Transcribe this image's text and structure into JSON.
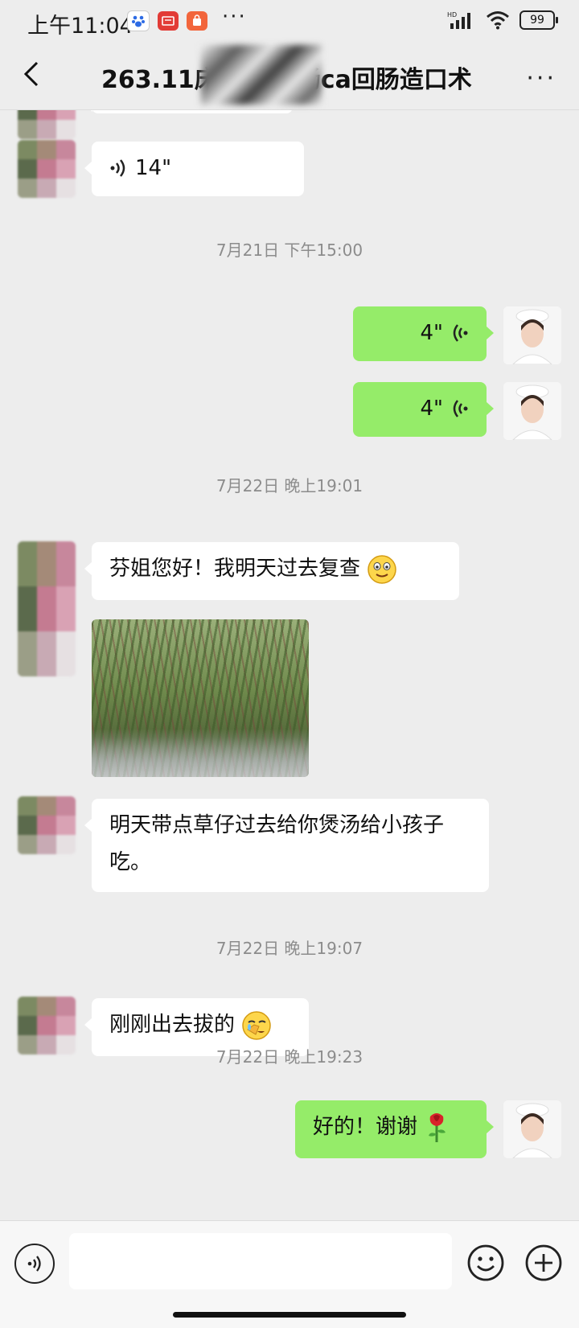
{
  "status_bar": {
    "time": "上午11:04",
    "network": "HD",
    "battery": "99",
    "more": "···"
  },
  "nav": {
    "title": "263.11床林 ██ 肠ca回肠造口术",
    "more": "···"
  },
  "messages": {
    "m1_voice": "14\"",
    "t1": "7月21日 下午15:00",
    "m2_voice": "4\"",
    "m3_voice": "4\"",
    "t2": "7月22日 晚上19:01",
    "m4_text": "芬姐您好！我明天过去复查",
    "m6_text": "明天带点草仔过去给你煲汤给小孩子吃。",
    "t3": "7月22日 晚上19:07",
    "m7_text": "刚刚出去拔的",
    "t4": "7月22日 晚上19:23",
    "m8_text": "好的！谢谢"
  },
  "input_bar": {
    "placeholder": ""
  },
  "colors": {
    "background": "#ededed",
    "self_bubble": "#95ec69",
    "other_bubble": "#ffffff"
  },
  "icons": [
    "back-arrow-icon",
    "more-icon",
    "voice-wave-icon",
    "smile-emoji-icon",
    "facepalm-emoji-icon",
    "rose-emoji-icon",
    "voice-input-icon",
    "emoji-icon",
    "plus-icon"
  ]
}
